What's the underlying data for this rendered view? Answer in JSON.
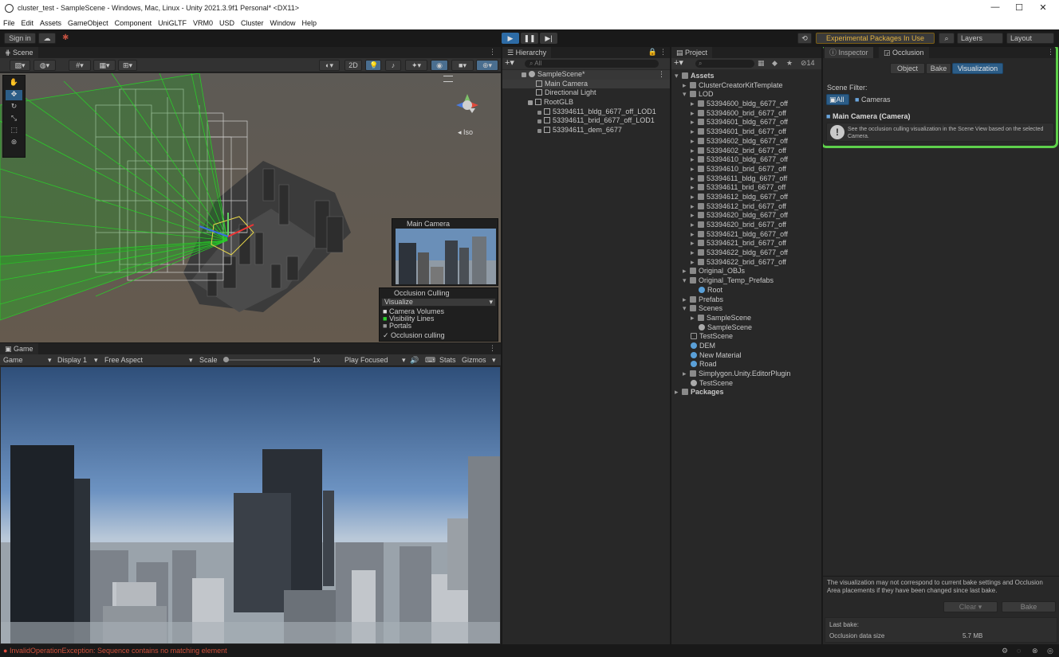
{
  "window": {
    "title": "cluster_test - SampleScene - Windows, Mac, Linux - Unity 2021.3.9f1 Personal* <DX11>"
  },
  "menu": [
    "File",
    "Edit",
    "Assets",
    "GameObject",
    "Component",
    "UniGLTF",
    "VRM0",
    "USD",
    "Cluster",
    "Window",
    "Help"
  ],
  "toolbar": {
    "signin": "Sign in",
    "packages": "Experimental Packages In Use",
    "layers": "Layers",
    "layout": "Layout"
  },
  "scene": {
    "tab": "Scene",
    "btn_2d": "2D",
    "iso": "Iso",
    "camera_preview": "Main Camera",
    "occlusion": {
      "title": "Occlusion Culling",
      "mode": "Visualize",
      "items": [
        "Camera Volumes",
        "Visibility Lines",
        "Portals"
      ],
      "culling": "Occlusion culling"
    }
  },
  "game": {
    "tab": "Game",
    "mode": "Game",
    "display": "Display 1",
    "aspect": "Free Aspect",
    "scale": "Scale",
    "scale_val": "1x",
    "play": "Play Focused",
    "stats": "Stats",
    "gizmos": "Gizmos"
  },
  "hierarchy": {
    "tab": "Hierarchy",
    "search": "All",
    "items": [
      "SampleScene*",
      "Main Camera",
      "Directional Light",
      "RootGLB",
      "53394611_bldg_6677_off_LOD1",
      "53394611_brid_6677_off_LOD1",
      "53394611_dem_6677"
    ]
  },
  "project": {
    "tab": "Project",
    "count": "14",
    "items": [
      "Assets",
      "ClusterCreatorKitTemplate",
      "LOD",
      "53394600_bldg_6677_off",
      "53394600_brid_6677_off",
      "53394601_bldg_6677_off",
      "53394601_brid_6677_off",
      "53394602_bldg_6677_off",
      "53394602_brid_6677_off",
      "53394610_bldg_6677_off",
      "53394610_brid_6677_off",
      "53394611_bldg_6677_off",
      "53394611_brid_6677_off",
      "53394612_bldg_6677_off",
      "53394612_brid_6677_off",
      "53394620_bldg_6677_off",
      "53394620_brid_6677_off",
      "53394621_bldg_6677_off",
      "53394621_brid_6677_off",
      "53394622_bldg_6677_off",
      "53394622_brid_6677_off",
      "Original_OBJs",
      "Original_Temp_Prefabs",
      "Root",
      "Prefabs",
      "Scenes",
      "SampleScene",
      "SampleScene",
      "TestScene",
      "DEM",
      "New Material",
      "Road",
      "Simplygon.Unity.EditorPlugin",
      "TestScene",
      "Packages"
    ]
  },
  "inspector": {
    "tab_inspector": "Inspector",
    "tab_occlusion": "Occlusion",
    "modes": [
      "Object",
      "Bake",
      "Visualization"
    ],
    "scene_filter": "Scene Filter:",
    "filter_all": "All",
    "filter_cameras": "Cameras",
    "camera": "Main Camera (Camera)",
    "info": "See the occlusion culling visualization in the Scene View based on the selected Camera.",
    "note": "The visualization may not correspond to current bake settings and Occlusion Area placements if they have been changed since last bake.",
    "clear": "Clear",
    "bake": "Bake",
    "last_bake": "Last bake:",
    "data_size_label": "Occlusion data size",
    "data_size": "5.7 MB"
  },
  "status": {
    "error": "InvalidOperationException: Sequence contains no matching element"
  },
  "colors": {
    "accent": "#4a9a3a",
    "highlight_border": "#5ed04b",
    "selected": "#2c5d87"
  }
}
